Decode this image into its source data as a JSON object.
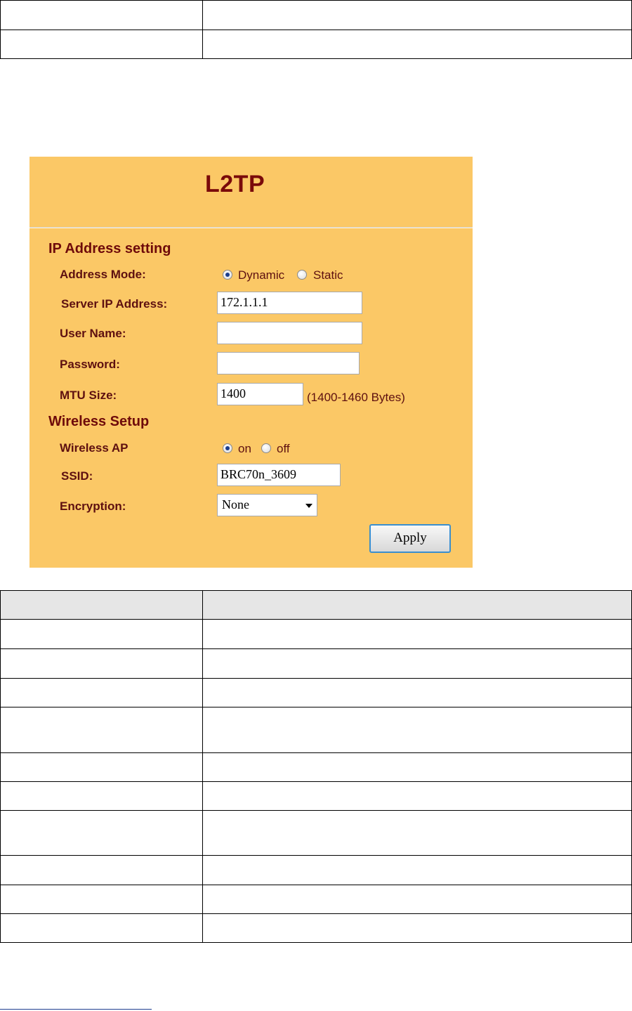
{
  "panel": {
    "title": "L2TP",
    "ip_section": "IP Address setting",
    "address_mode_label": "Address Mode:",
    "address_mode_options": [
      "Dynamic",
      "Static"
    ],
    "address_mode_selected": "Dynamic",
    "server_ip_label": "Server IP Address:",
    "server_ip_value": "172.1.1.1",
    "user_name_label": "User Name:",
    "user_name_value": "",
    "password_label": "Password:",
    "password_value": "",
    "mtu_label": "MTU Size:",
    "mtu_value": "1400",
    "mtu_hint": "(1400-1460 Bytes)",
    "wireless_section": "Wireless Setup",
    "wireless_ap_label": "Wireless AP",
    "wireless_ap_options": [
      "on",
      "off"
    ],
    "wireless_ap_selected": "on",
    "ssid_label": "SSID:",
    "ssid_value": "BRC70n_3609",
    "encryption_label": "Encryption:",
    "encryption_value": "None",
    "apply_label": "Apply"
  },
  "colors": {
    "panel_bg": "#fbc866",
    "label_text": "#5e1010",
    "title_text": "#7a0a0a",
    "apply_border": "#3a8fcf"
  }
}
